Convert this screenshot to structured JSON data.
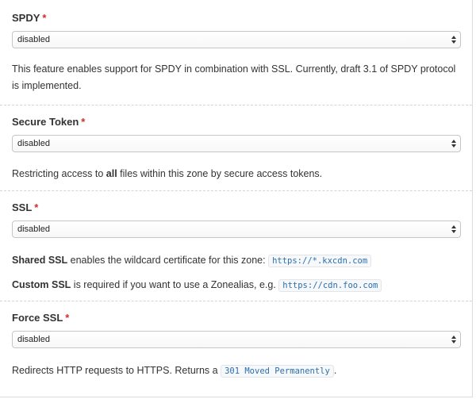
{
  "spdy": {
    "label": "SPDY",
    "required_mark": "*",
    "select_value": "disabled",
    "description": "This feature enables support for SPDY in combination with SSL. Currently, draft 3.1 of SPDY protocol is implemented."
  },
  "secure_token": {
    "label": "Secure Token",
    "required_mark": "*",
    "select_value": "disabled",
    "desc_before": "Restricting access to ",
    "desc_bold": "all",
    "desc_after": " files within this zone by secure access tokens."
  },
  "ssl": {
    "label": "SSL",
    "required_mark": "*",
    "select_value": "disabled",
    "shared_bold": "Shared SSL",
    "shared_text": " enables the wildcard certificate for this zone: ",
    "shared_code": "https://*.kxcdn.com",
    "custom_bold": "Custom SSL",
    "custom_text": " is required if you want to use a Zonealias, e.g. ",
    "custom_code": "https://cdn.foo.com"
  },
  "force_ssl": {
    "label": "Force SSL",
    "required_mark": "*",
    "select_value": "disabled",
    "desc_before": "Redirects HTTP requests to HTTPS. Returns a ",
    "desc_code": "301 Moved Permanently",
    "desc_after": "."
  },
  "icons": {
    "select_arrows": "up-down-arrows-icon"
  },
  "colors": {
    "required": "#c9302c",
    "code_text": "#2a6fb0"
  }
}
